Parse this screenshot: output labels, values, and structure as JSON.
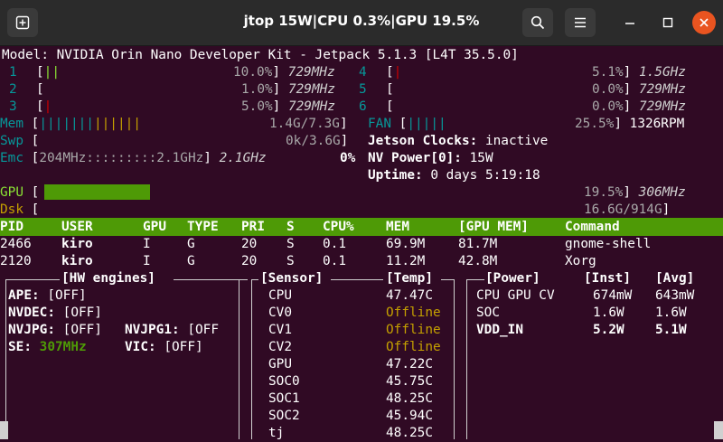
{
  "window": {
    "title": "jtop 15W|CPU 0.3%|GPU 19.5%",
    "new_tab_icon": "new-tab-icon",
    "search_icon": "search-icon",
    "menu_icon": "hamburger-menu-icon",
    "minimize_icon": "minimize-icon",
    "maximize_icon": "maximize-icon",
    "close_icon": "close-icon"
  },
  "header": {
    "model": "Model: NVIDIA Orin Nano Developer Kit - Jetpack 5.1.3 [L4T 35.5.0]"
  },
  "cpus": [
    {
      "id": "1",
      "pct": "10.0%",
      "freq": "729MHz",
      "bars": "||"
    },
    {
      "id": "2",
      "pct": "1.0%",
      "freq": "729MHz",
      "bars": ""
    },
    {
      "id": "3",
      "pct": "5.0%",
      "freq": "729MHz",
      "bars": "|"
    },
    {
      "id": "4",
      "pct": "5.1%",
      "freq": "1.5GHz",
      "bars": "|"
    },
    {
      "id": "5",
      "pct": "0.0%",
      "freq": "729MHz",
      "bars": ""
    },
    {
      "id": "6",
      "pct": "0.0%",
      "freq": "729MHz",
      "bars": ""
    }
  ],
  "mem": {
    "mem_label": "Mem",
    "mem_bars_used": "|||||||",
    "mem_bars_cache": "||||||",
    "mem_value": "1.4G/7.3G",
    "swp_label": "Swp",
    "swp_value": "0k/3.6G",
    "emc_label": "Emc",
    "emc_bar": "204MHz:::::::::2.1GHz",
    "emc_freq": "2.1GHz",
    "emc_pct": "0%"
  },
  "fan": {
    "label": "FAN",
    "bars": "|||||",
    "pct": "25.5%",
    "rpm": "1326RPM"
  },
  "status": {
    "clocks_label": "Jetson Clocks:",
    "clocks_value": "inactive",
    "power_label": "NV Power[0]:",
    "power_value": "15W",
    "uptime_label": "Uptime:",
    "uptime_value": "0 days 5:19:18"
  },
  "gpu": {
    "label": "GPU",
    "pct": "19.5%",
    "level": 0.195,
    "freq": "306MHz"
  },
  "disk": {
    "label": "Dsk",
    "value": "16.6G/914G"
  },
  "processes": {
    "columns": [
      "PID",
      "USER",
      "GPU",
      "TYPE",
      "PRI",
      "S",
      "CPU%",
      "MEM",
      "[GPU MEM]",
      "Command"
    ],
    "rows": [
      [
        "2466",
        "kiro",
        "I",
        "G",
        "20",
        "S",
        "0.1",
        "69.9M",
        "81.7M",
        "gnome-shell"
      ],
      [
        "2120",
        "kiro",
        "I",
        "G",
        "20",
        "S",
        "0.1",
        "11.2M",
        "42.8M",
        "Xorg"
      ]
    ]
  },
  "hw_engines": {
    "title": "[HW engines]",
    "ape_label": "APE:",
    "ape_value": "[OFF]",
    "nvdec_label": "NVDEC:",
    "nvdec_value": "[OFF]",
    "nvjpg_label": "NVJPG:",
    "nvjpg_value": "[OFF]",
    "nvjpg1_label": "NVJPG1:",
    "nvjpg1_value": "[OFF",
    "se_label": "SE:",
    "se_value": "307MHz",
    "vic_label": "VIC:",
    "vic_value": "[OFF]"
  },
  "sensors": {
    "title": "[Sensor]",
    "temp_title": "[Temp]",
    "rows": [
      {
        "name": "CPU",
        "temp": "47.47C"
      },
      {
        "name": "CV0",
        "temp": "Offline"
      },
      {
        "name": "CV1",
        "temp": "Offline"
      },
      {
        "name": "CV2",
        "temp": "Offline"
      },
      {
        "name": "GPU",
        "temp": "47.22C"
      },
      {
        "name": "SOC0",
        "temp": "45.75C"
      },
      {
        "name": "SOC1",
        "temp": "48.25C"
      },
      {
        "name": "SOC2",
        "temp": "45.94C"
      },
      {
        "name": "tj",
        "temp": "48.25C"
      }
    ]
  },
  "power": {
    "title": "[Power]",
    "inst_title": "[Inst]",
    "avg_title": "[Avg]",
    "rows": [
      {
        "name": "CPU GPU CV",
        "inst": "674mW",
        "avg": "643mW"
      },
      {
        "name": "SOC",
        "inst": "1.6W",
        "avg": "1.6W"
      },
      {
        "name": "VDD_IN",
        "inst": "5.2W",
        "avg": "5.1W"
      }
    ]
  },
  "colors": {
    "terminal_bg": "#300a24",
    "accent_green": "#4e9a06",
    "offline_yellow": "#c4a000",
    "ubuntu_orange": "#e95420"
  }
}
